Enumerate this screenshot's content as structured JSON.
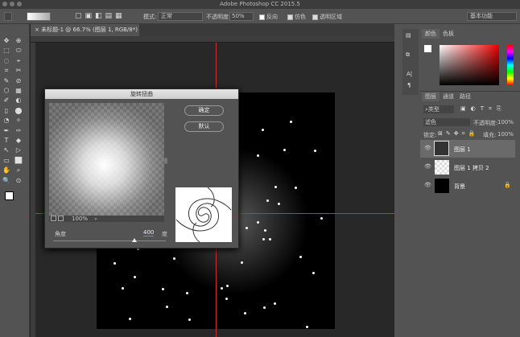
{
  "app": {
    "title": "Adobe Photoshop CC 2015.5"
  },
  "options": {
    "mode_label": "模式:",
    "mode_value": "正常",
    "opacity_label": "不透明度:",
    "opacity_value": "50%",
    "reverse_label": "反向",
    "dither_label": "仿色",
    "transparency_label": "透明区域",
    "workspace": "基本功能"
  },
  "document": {
    "tab_title": "未标题-1 @ 66.7% (图层 1, RGB/8*) *"
  },
  "color_panel": {
    "tabs": [
      "颜色",
      "色板"
    ]
  },
  "layers_panel": {
    "tabs": [
      "图层",
      "通道",
      "路径"
    ],
    "filter_kind": "类型",
    "blend_mode": "滤色",
    "opacity_label": "不透明度:",
    "opacity_value": "100%",
    "lock_label": "锁定:",
    "fill_label": "填充:",
    "fill_value": "100%",
    "layers": [
      {
        "name": "图层 1",
        "selected": true
      },
      {
        "name": "图层 1 拷贝 2",
        "selected": false
      },
      {
        "name": "背景",
        "selected": false,
        "locked": true
      }
    ]
  },
  "dialog": {
    "title": "旋转扭曲",
    "ok_label": "确定",
    "default_label": "默认",
    "zoom_value": "100%",
    "angle_label": "角度",
    "angle_value": "400",
    "angle_unit": "度",
    "angle_fraction": 0.72
  }
}
